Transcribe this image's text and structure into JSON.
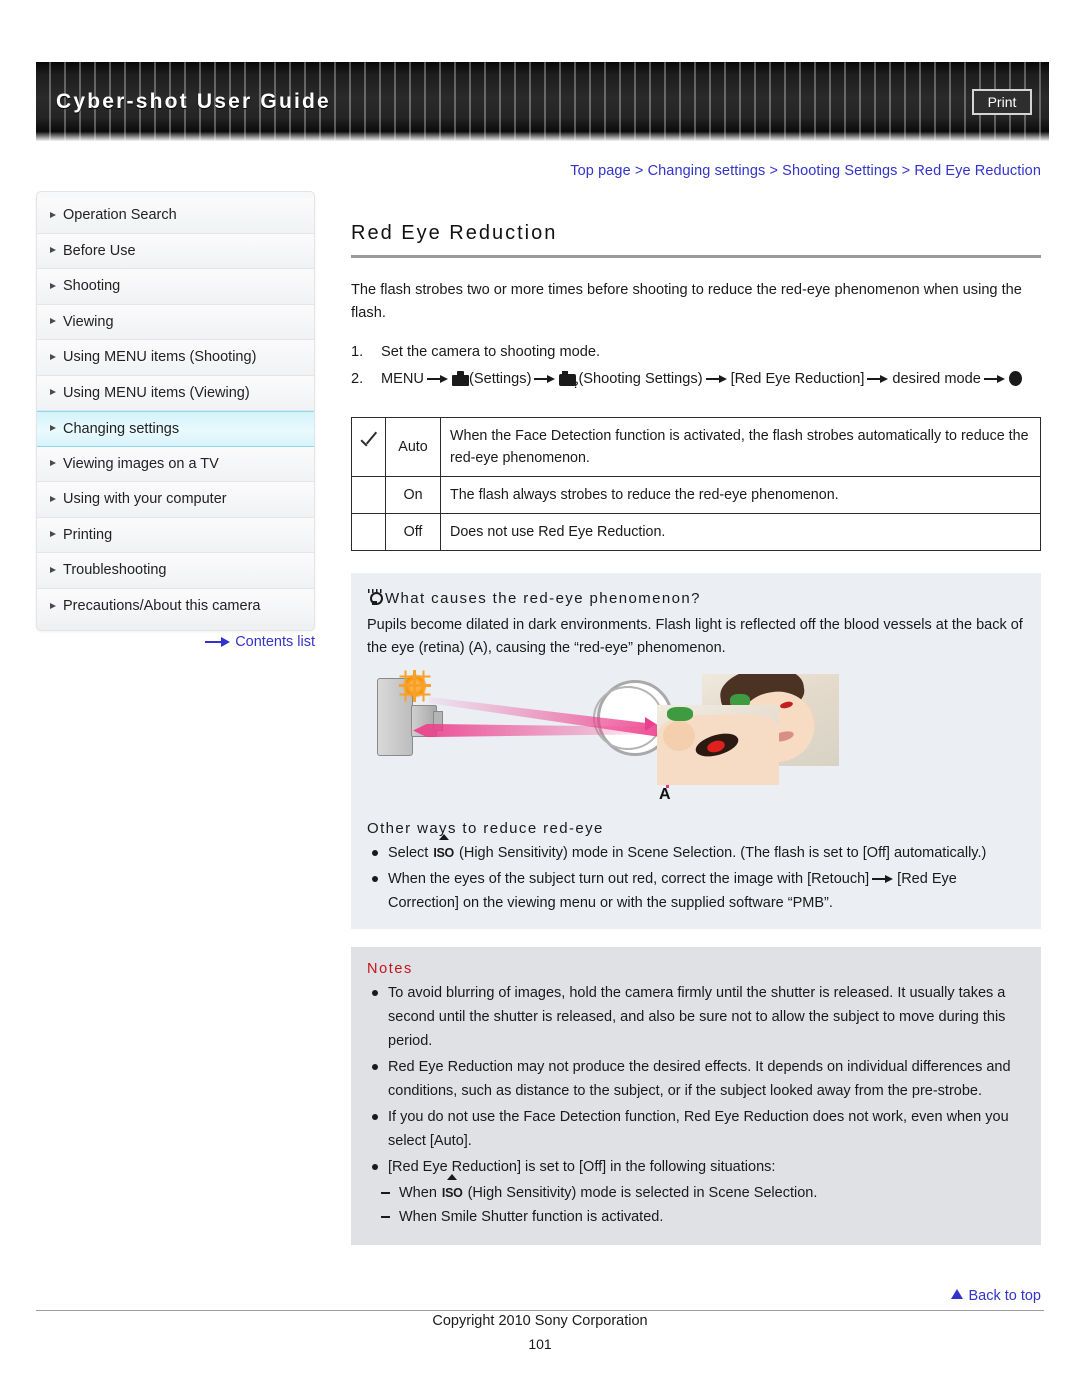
{
  "header": {
    "title": "Cyber-shot User Guide",
    "print_label": "Print"
  },
  "breadcrumb": {
    "text": "Top page > Changing settings > Shooting Settings > Red Eye Reduction"
  },
  "sidebar": {
    "items": [
      {
        "label": "Operation Search",
        "active": false
      },
      {
        "label": "Before Use",
        "active": false
      },
      {
        "label": "Shooting",
        "active": false
      },
      {
        "label": "Viewing",
        "active": false
      },
      {
        "label": "Using MENU items (Shooting)",
        "active": false
      },
      {
        "label": "Using MENU items (Viewing)",
        "active": false
      },
      {
        "label": "Changing settings",
        "active": true
      },
      {
        "label": "Viewing images on a TV",
        "active": false
      },
      {
        "label": "Using with your computer",
        "active": false
      },
      {
        "label": "Printing",
        "active": false
      },
      {
        "label": "Troubleshooting",
        "active": false
      },
      {
        "label": "Precautions/About this camera",
        "active": false
      }
    ],
    "contents_list_label": "Contents list"
  },
  "main": {
    "title": "Red Eye Reduction",
    "intro": "The flash strobes two or more times before shooting to reduce the red-eye phenomenon when using the flash.",
    "step1_num": "1.",
    "step1_text": "Set the camera to shooting mode.",
    "step2_num": "2.",
    "step2_a": "MENU",
    "step2_b": "(Settings)",
    "step2_c": "(Shooting Settings)",
    "step2_d": "[Red Eye Reduction]",
    "step2_e": "desired mode",
    "table": {
      "rows": [
        {
          "checked": true,
          "name": "Auto",
          "desc": "When the Face Detection function is activated, the flash strobes automatically to reduce the red-eye phenomenon."
        },
        {
          "checked": false,
          "name": "On",
          "desc": "The flash always strobes to reduce the red-eye phenomenon."
        },
        {
          "checked": false,
          "name": "Off",
          "desc": "Does not use Red Eye Reduction."
        }
      ]
    },
    "tip": {
      "heading": "What causes the red-eye phenomenon?",
      "body": "Pupils become dilated in dark environments. Flash light is reflected off the blood vessels at the back of the eye (retina) (A), causing the “red-eye” phenomenon.",
      "diagram_label_a": "A",
      "subheading": "Other ways to reduce red-eye",
      "bullets": [
        {
          "pre": "Select",
          "iso": "ISO",
          "post": "(High Sensitivity) mode in Scene Selection. (The flash is set to [Off] automatically.)"
        },
        {
          "pre": "When the eyes of the subject turn out red, correct the image with [Retouch]",
          "iso": "",
          "post": "[Red Eye Correction] on the viewing menu or with the supplied software “PMB”."
        }
      ]
    },
    "notes": {
      "heading": "Notes",
      "items": [
        "To avoid blurring of images, hold the camera firmly until the shutter is released. It usually takes a second until the shutter is released, and also be sure not to allow the subject to move during this period.",
        "Red Eye Reduction may not produce the desired effects. It depends on individual differences and conditions, such as distance to the subject, or if the subject looked away from the pre-strobe.",
        "If you do not use the Face Detection function, Red Eye Reduction does not work, even when you select [Auto].",
        "[Red Eye Reduction] is set to [Off] in the following situations:"
      ],
      "sub_pre": "When",
      "sub_iso": "ISO",
      "sub_post": "(High Sensitivity) mode is selected in Scene Selection.",
      "sub_item2": "When Smile Shutter function is activated."
    }
  },
  "footer": {
    "back_to_top": "Back to top",
    "copyright": "Copyright 2010 Sony Corporation",
    "page_number": "101"
  },
  "colors": {
    "link": "#3333cc",
    "notes_heading": "#c5131b",
    "tip_bg": "#ebeef3",
    "notes_bg": "#dfe1e5",
    "active_nav": "#d3f2fb"
  }
}
